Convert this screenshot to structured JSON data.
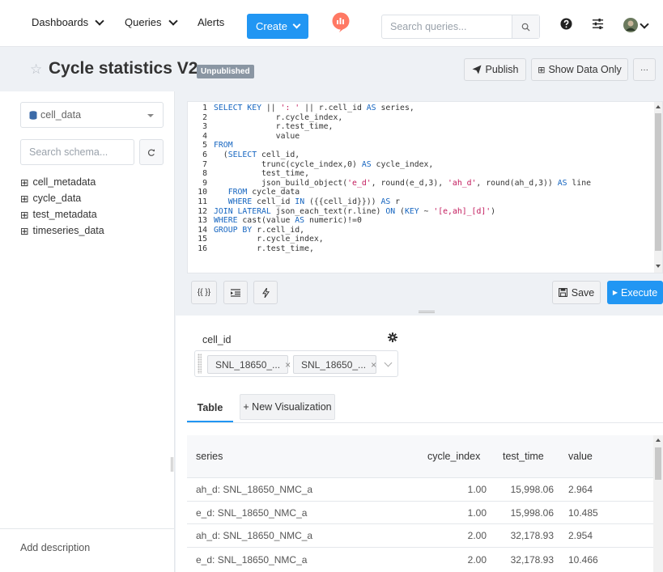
{
  "nav": {
    "dashboards": "Dashboards",
    "queries": "Queries",
    "alerts": "Alerts",
    "create": "Create",
    "search_placeholder": "Search queries...",
    "logo_color": "#ff7964",
    "accent": "#2196f3"
  },
  "header": {
    "title": "Cycle statistics V2",
    "badge": "Unpublished",
    "publish": "Publish",
    "show_data_only": "Show Data Only",
    "more": "···"
  },
  "schema": {
    "datasource": "cell_data",
    "search_placeholder": "Search schema...",
    "tables": [
      "cell_metadata",
      "cycle_data",
      "test_metadata",
      "timeseries_data"
    ],
    "add_description": "Add description"
  },
  "editor": {
    "lines": [
      "SELECT KEY || ': ' || r.cell_id AS series,",
      "             r.cycle_index,",
      "             r.test_time,",
      "             value",
      "FROM",
      "  (SELECT cell_id,",
      "          trunc(cycle_index,0) AS cycle_index,",
      "          test_time,",
      "          json_build_object('e_d', round(e_d,3), 'ah_d', round(ah_d,3)) AS line",
      "   FROM cycle_data",
      "   WHERE cell_id IN ({{cell_id}})) AS r",
      "JOIN LATERAL json_each_text(r.line) ON (KEY ~ '[e,ah]_[d]')",
      "WHERE cast(value AS numeric)!=0",
      "GROUP BY r.cell_id,",
      "         r.cycle_index,",
      "         r.test_time,"
    ],
    "params_button": "{{ }}",
    "save": "Save",
    "execute": "Execute"
  },
  "params": {
    "label": "cell_id",
    "values": [
      "SNL_18650_...",
      "SNL_18650_..."
    ]
  },
  "tabs": {
    "table": "Table",
    "new_vis": "+ New Visualization"
  },
  "results": {
    "columns": [
      "series",
      "cycle_index",
      "test_time",
      "value"
    ],
    "rows": [
      {
        "series": "ah_d: SNL_18650_NMC_a",
        "cycle_index": "1.00",
        "test_time": "15,998.06",
        "value": "2.964"
      },
      {
        "series": "e_d: SNL_18650_NMC_a",
        "cycle_index": "1.00",
        "test_time": "15,998.06",
        "value": "10.485"
      },
      {
        "series": "ah_d: SNL_18650_NMC_a",
        "cycle_index": "2.00",
        "test_time": "32,178.93",
        "value": "2.954"
      },
      {
        "series": "e_d: SNL_18650_NMC_a",
        "cycle_index": "2.00",
        "test_time": "32,178.93",
        "value": "10.466"
      }
    ]
  }
}
